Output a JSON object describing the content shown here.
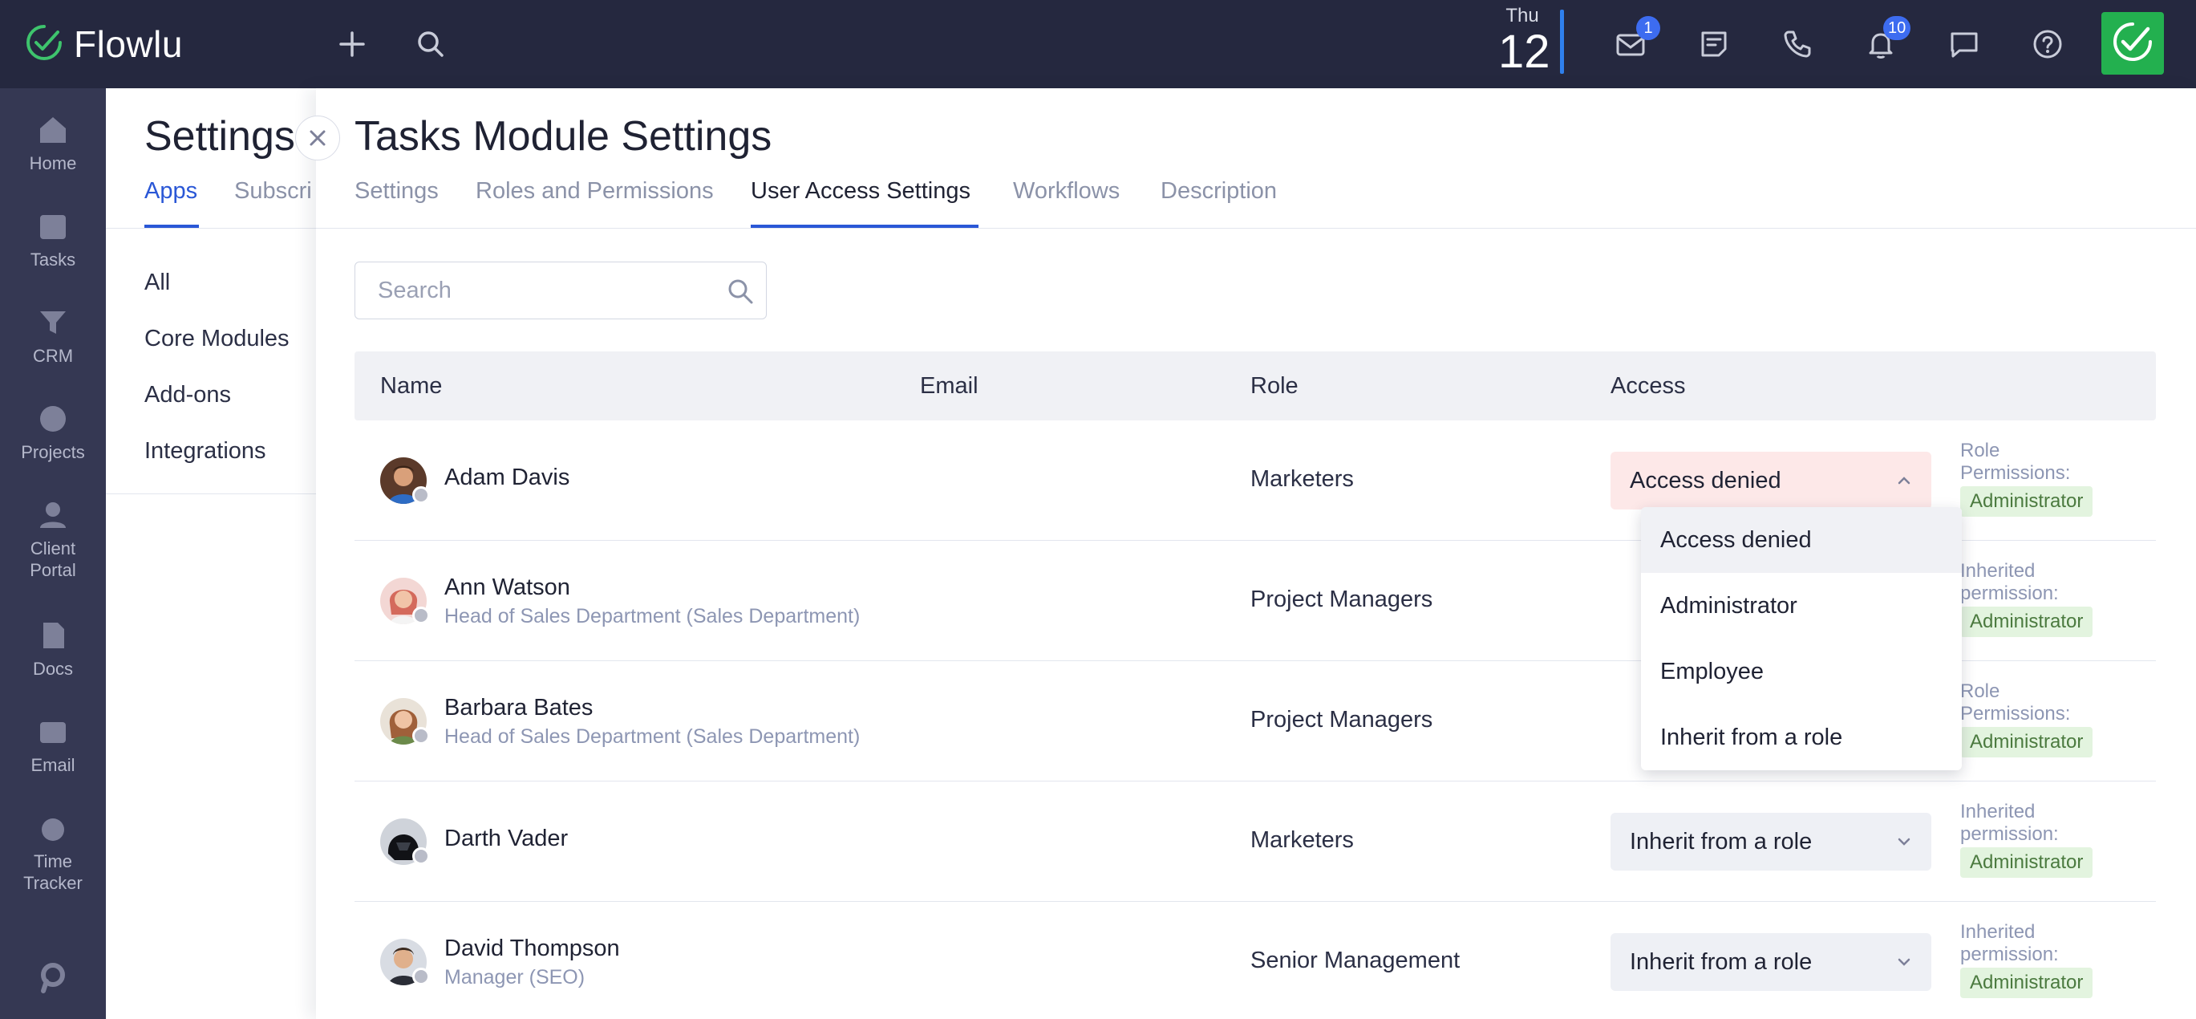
{
  "app": {
    "name": "Flowlu"
  },
  "topbar": {
    "date_dow": "Thu",
    "date_day": "12",
    "mail_badge": "1",
    "notifications_badge": "10"
  },
  "leftnav": {
    "items": [
      {
        "label": "Home"
      },
      {
        "label": "Tasks"
      },
      {
        "label": "CRM"
      },
      {
        "label": "Projects"
      },
      {
        "label": "Client\nPortal"
      },
      {
        "label": "Docs"
      },
      {
        "label": "Email"
      },
      {
        "label": "Time\nTracker"
      }
    ]
  },
  "settings": {
    "title": "Settings",
    "tabs": [
      "Apps",
      "Subscri"
    ],
    "links": [
      "All",
      "Core Modules",
      "Add-ons",
      "Integrations"
    ]
  },
  "main": {
    "title": "Tasks Module Settings",
    "tabs": [
      "Settings",
      "Roles and Permissions",
      "User Access Settings",
      "Workflows",
      "Description"
    ],
    "search_placeholder": "Search",
    "columns": [
      "Name",
      "Email",
      "Role",
      "Access"
    ],
    "rows": [
      {
        "name": "Adam Davis",
        "subtitle": "",
        "role": "Marketers",
        "access": "Access denied",
        "perm_label": "Role\nPermissions:",
        "perm_value": "Administrator"
      },
      {
        "name": "Ann Watson",
        "subtitle": "Head of Sales Department (Sales Department)",
        "role": "Project Managers",
        "access": "",
        "perm_label": "Inherited\npermission:",
        "perm_value": "Administrator"
      },
      {
        "name": "Barbara Bates",
        "subtitle": "Head of Sales Department (Sales Department)",
        "role": "Project Managers",
        "access": "",
        "perm_label": "Role\nPermissions:",
        "perm_value": "Administrator"
      },
      {
        "name": "Darth Vader",
        "subtitle": "",
        "role": "Marketers",
        "access": "Inherit from a role",
        "perm_label": "Inherited\npermission:",
        "perm_value": "Administrator"
      },
      {
        "name": "David Thompson",
        "subtitle": "Manager (SEO)",
        "role": "Senior Management",
        "access": "Inherit from a role",
        "perm_label": "Inherited\npermission:",
        "perm_value": "Administrator"
      }
    ],
    "dropdown_options": [
      "Access denied",
      "Administrator",
      "Employee",
      "Inherit from a role"
    ]
  },
  "colors": {
    "topbar": "#25283f",
    "leftnav": "#353853",
    "accent": "#2a57d6",
    "brand_green": "#23b04f",
    "denied_bg": "#fde8e8",
    "perm_badge_bg": "#e3f4df"
  }
}
